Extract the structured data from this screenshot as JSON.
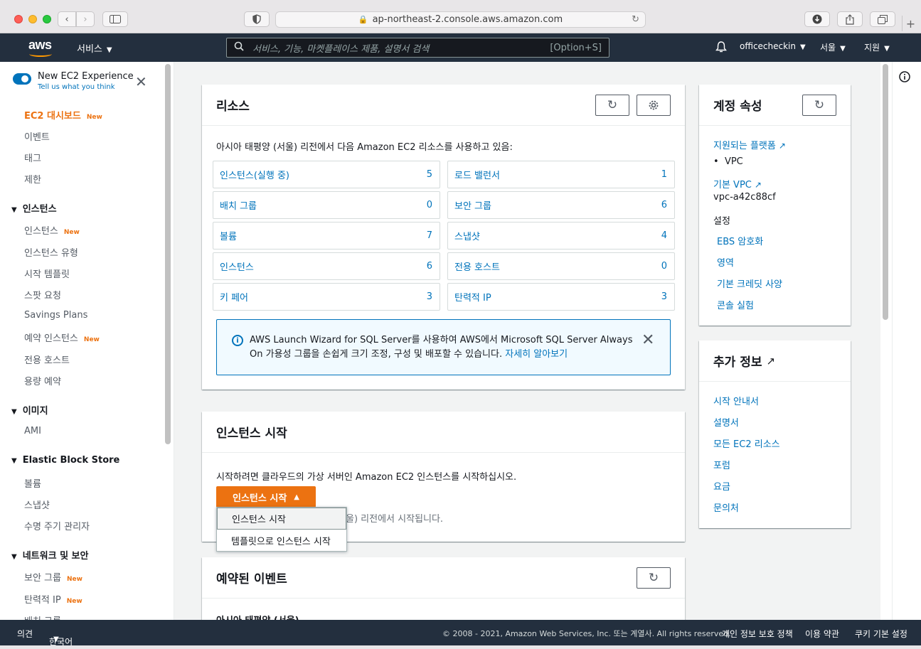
{
  "browser": {
    "url": "ap-northeast-2.console.aws.amazon.com",
    "back_icon": "chevron-left-icon",
    "forward_icon": "chevron-right-icon"
  },
  "nav": {
    "logo": "aws",
    "services": "서비스",
    "search_placeholder": "서비스, 기능, 마켓플레이스 제품, 설명서 검색",
    "search_shortcut": "[Option+S]",
    "account": "officecheckin",
    "region": "서울",
    "support": "지원"
  },
  "sidebar": {
    "toggle_title": "New EC2 Experience",
    "toggle_link": "Tell us what you think",
    "new_badge": "New",
    "top_items": [
      {
        "label": "EC2 대시보드",
        "new": true
      },
      {
        "label": "이벤트"
      },
      {
        "label": "태그"
      },
      {
        "label": "제한"
      }
    ],
    "sections": [
      {
        "title": "인스턴스",
        "items": [
          "인스턴스",
          "인스턴스 유형",
          "시작 템플릿",
          "스팟 요청",
          "Savings Plans",
          "예약 인스턴스",
          "전용 호스트",
          "용량 예약"
        ]
      },
      {
        "title": "이미지",
        "items": [
          "AMI"
        ]
      },
      {
        "title": "Elastic Block Store",
        "items": [
          "볼륨",
          "스냅샷",
          "수명 주기 관리자"
        ]
      },
      {
        "title": "네트워크 및 보안",
        "items": [
          "보안 그룹",
          "탄력적 IP",
          "배치 그룹"
        ]
      }
    ]
  },
  "resources": {
    "title": "리소스",
    "description": "아시아 태평양 (서울) 리전에서 다음 Amazon EC2 리소스를 사용하고 있음:",
    "items": [
      {
        "label": "인스턴스(실행 중)",
        "count": "5"
      },
      {
        "label": "로드 밸런서",
        "count": "1"
      },
      {
        "label": "배치 그룹",
        "count": "0"
      },
      {
        "label": "보안 그룹",
        "count": "6"
      },
      {
        "label": "볼륨",
        "count": "7"
      },
      {
        "label": "스냅샷",
        "count": "4"
      },
      {
        "label": "인스턴스",
        "count": "6"
      },
      {
        "label": "전용 호스트",
        "count": "0"
      },
      {
        "label": "키 페어",
        "count": "3"
      },
      {
        "label": "탄력적 IP",
        "count": "3"
      }
    ],
    "alert_text": "AWS Launch Wizard for SQL Server를 사용하여 AWS에서 Microsoft SQL Server Always On 가용성 그룹을 손쉽게 크기 조정, 구성 및 배포할 수 있습니다.",
    "alert_link": "자세히 알아보기"
  },
  "launch": {
    "title": "인스턴스 시작",
    "description": "시작하려면 클라우드의 가상 서버인 Amazon EC2 인스턴스를 시작하십시오.",
    "button": "인스턴스 시작",
    "note_visible": "울) 리전에서 시작됩니다.",
    "menu": [
      "인스턴스 시작",
      "템플릿으로 인스턴스 시작"
    ]
  },
  "events": {
    "title": "예약된 이벤트",
    "partial_text": "아시아 태평양 (서울)"
  },
  "account": {
    "title": "계정 속성",
    "platforms_link": "지원되는 플랫폼",
    "platform_item": "VPC",
    "default_vpc_link": "기본 VPC",
    "default_vpc_value": "vpc-a42c88cf",
    "settings_label": "설정",
    "settings": [
      "EBS 암호화",
      "영역",
      "기본 크레딧 사양",
      "콘솔 실험"
    ]
  },
  "more_info": {
    "title": "추가 정보",
    "links": [
      "시작 안내서",
      "설명서",
      "모든 EC2 리소스",
      "포럼",
      "요금",
      "문의처"
    ]
  },
  "footer": {
    "feedback": "의견",
    "language": "한국어",
    "copyright": "© 2008 - 2021, Amazon Web Services, Inc. 또는 계열사. All rights reserved.",
    "privacy": "개인 정보 보호 정책",
    "terms": "이용 약관",
    "cookies": "쿠키 기본 설정"
  }
}
